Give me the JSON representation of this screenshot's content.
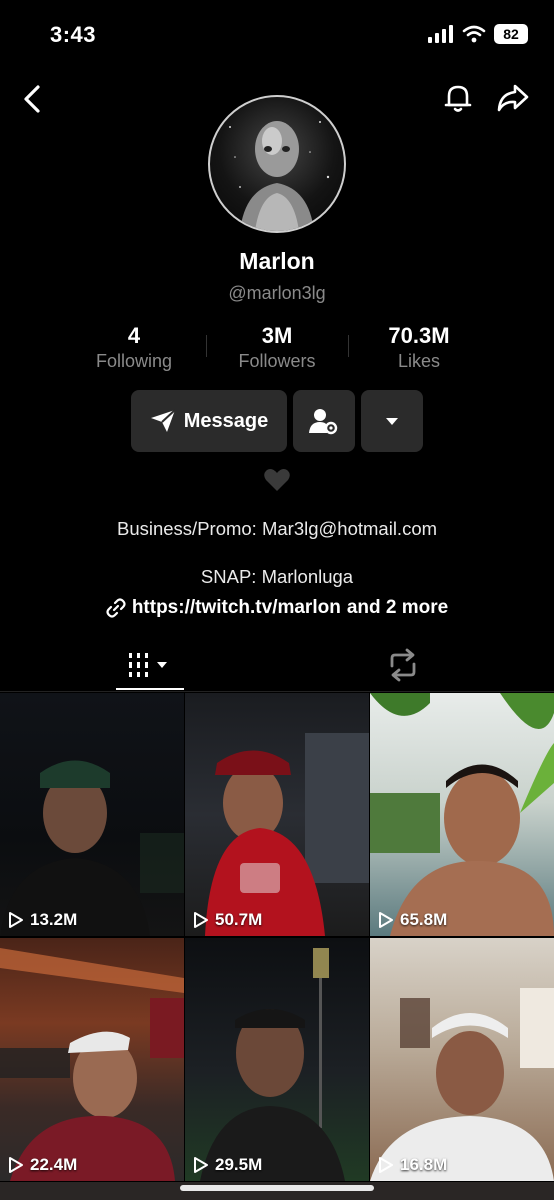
{
  "status_bar": {
    "time": "3:43",
    "battery": "82"
  },
  "profile": {
    "name": "Marlon",
    "handle": "@marlon3lg",
    "stats": [
      {
        "value": "4",
        "label": "Following"
      },
      {
        "value": "3M",
        "label": "Followers"
      },
      {
        "value": "70.3M",
        "label": "Likes"
      }
    ],
    "message_label": "Message",
    "bio": [
      "Business/Promo: Mar3lg@hotmail.com",
      "SNAP: Marlonluga"
    ],
    "link": "https://twitch.tv/marlon",
    "link_more": "and 2 more"
  },
  "icons": {
    "back": "chevron-left-icon",
    "notifications": "bell-icon",
    "share": "share-icon",
    "message": "paper-plane-icon",
    "friend_settings": "user-gear-icon",
    "more": "caret-down-icon",
    "heart": "black-heart-icon",
    "link": "link-icon",
    "videos_tab": "grid-icon",
    "reposts_tab": "repost-icon"
  },
  "videos": [
    {
      "views": "13.2M"
    },
    {
      "views": "50.7M"
    },
    {
      "views": "65.8M"
    },
    {
      "views": "22.4M"
    },
    {
      "views": "29.5M"
    },
    {
      "views": "16.8M"
    }
  ],
  "colors": {
    "background": "#000000",
    "button": "#2b2b2b",
    "muted_text": "#8a8a8a"
  }
}
